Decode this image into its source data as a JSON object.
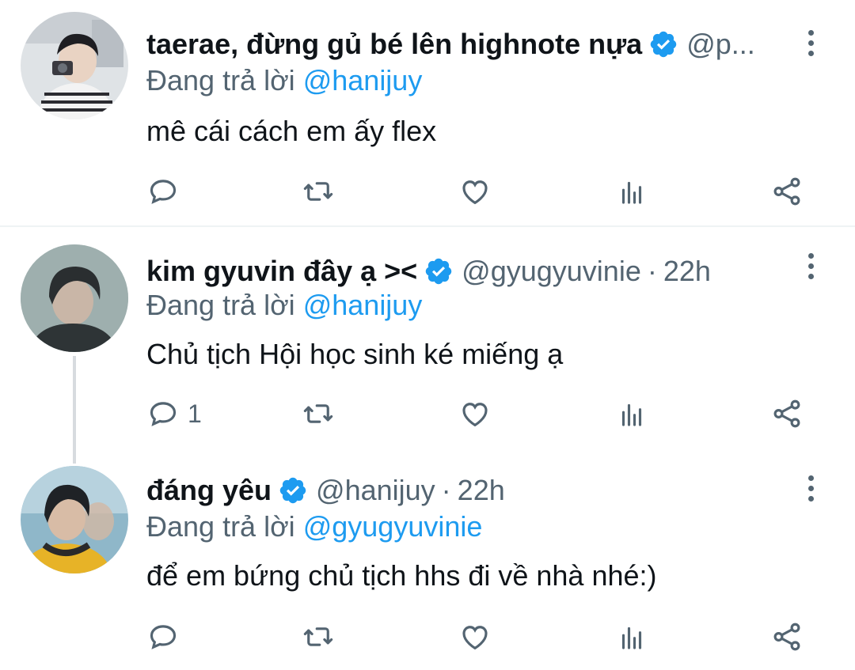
{
  "colors": {
    "link": "#1d9bf0",
    "muted": "#536471",
    "text": "#0f1419",
    "verified": "#1d9bf0"
  },
  "replying_prefix": "Đang trả lời",
  "tweets": [
    {
      "name": "taerae, đừng gủ bé lên highnote nựa",
      "verified": true,
      "handle": "@p...",
      "time": "",
      "reply_to": "@hanijuy",
      "text": "mê cái cách em ấy flex",
      "reply_count": "",
      "avatar_icon": "user-avatar-photo"
    },
    {
      "name": "kim gyuvin đây ạ ><",
      "verified": true,
      "handle": "@gyugyuvinie",
      "time": "22h",
      "reply_to": "@hanijuy",
      "text": "Chủ tịch Hội học sinh ké miếng ạ",
      "reply_count": "1",
      "avatar_icon": "user-avatar-photo"
    },
    {
      "name": "đáng yêu",
      "verified": true,
      "handle": "@hanijuy",
      "time": "22h",
      "reply_to": "@gyugyuvinie",
      "text": "để em bứng chủ tịch hhs đi về nhà nhé:)",
      "reply_count": "",
      "avatar_icon": "user-avatar-photo"
    }
  ],
  "dot_separator": "·",
  "action_icons": [
    "reply-icon",
    "retweet-icon",
    "like-icon",
    "analytics-icon",
    "share-icon"
  ]
}
